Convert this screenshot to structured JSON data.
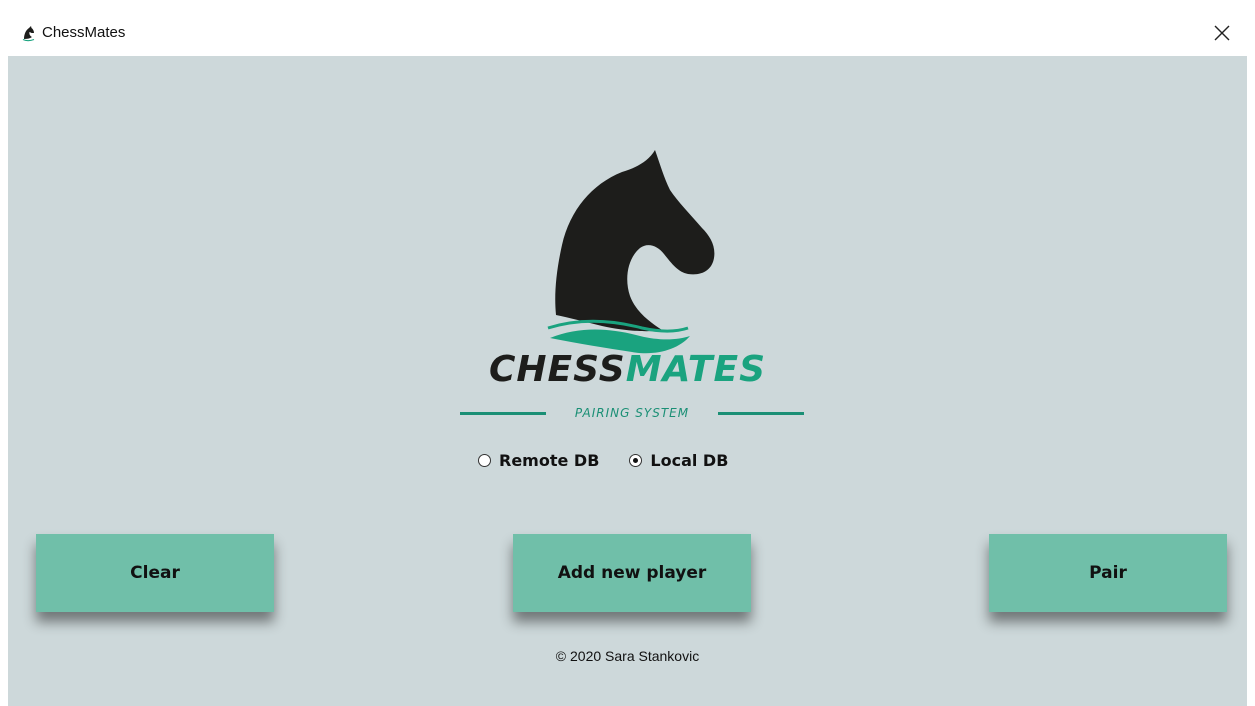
{
  "window": {
    "title": "ChessMates",
    "icon": "knight-icon"
  },
  "logo": {
    "brand_part1": "CHESS",
    "brand_part2": "MATES",
    "tagline": "PAIRING SYSTEM",
    "colors": {
      "dark": "#1d1d1b",
      "accent": "#1aa37f"
    }
  },
  "db_options": [
    {
      "label": "Remote DB",
      "selected": false
    },
    {
      "label": "Local DB",
      "selected": true
    }
  ],
  "buttons": {
    "clear": "Clear",
    "add_player": "Add new player",
    "pair": "Pair"
  },
  "footer": "© 2020 Sara Stankovic",
  "colors": {
    "background": "#cdd8da",
    "button": "#70bfa9"
  }
}
